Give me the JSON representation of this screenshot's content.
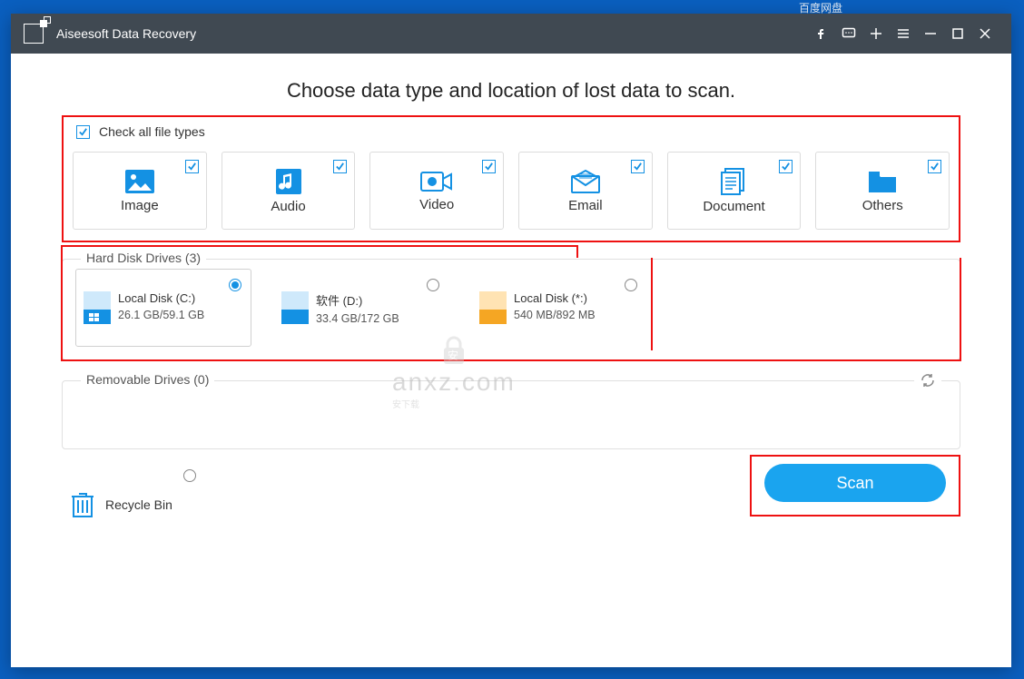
{
  "desktop": {
    "tray_text": "百度网盘"
  },
  "titlebar": {
    "title": "Aiseesoft Data Recovery"
  },
  "instruction": "Choose data type and location of lost data to scan.",
  "types": {
    "check_all_label": "Check all file types",
    "check_all_checked": true,
    "items": [
      {
        "label": "Image",
        "checked": true
      },
      {
        "label": "Audio",
        "checked": true
      },
      {
        "label": "Video",
        "checked": true
      },
      {
        "label": "Email",
        "checked": true
      },
      {
        "label": "Document",
        "checked": true
      },
      {
        "label": "Others",
        "checked": true
      }
    ]
  },
  "hdd": {
    "section_label": "Hard Disk Drives (3)",
    "drives": [
      {
        "name": "Local Disk (C:)",
        "size": "26.1 GB/59.1 GB",
        "selected": true,
        "style": "win"
      },
      {
        "name": "软件 (D:)",
        "size": "33.4 GB/172 GB",
        "selected": false,
        "style": "blue"
      },
      {
        "name": "Local Disk (*:)",
        "size": "540 MB/892 MB",
        "selected": false,
        "style": "orange"
      }
    ]
  },
  "removable": {
    "section_label": "Removable Drives (0)"
  },
  "recycle": {
    "label": "Recycle Bin",
    "selected": false
  },
  "scan": {
    "label": "Scan"
  },
  "watermark": {
    "line1": "安",
    "line2": "anxz.com",
    "line3": "安下载"
  }
}
